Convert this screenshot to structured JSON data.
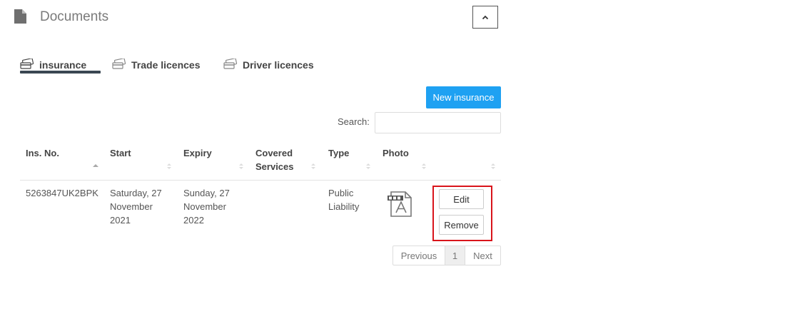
{
  "panel": {
    "title": "Documents",
    "icon": "document-icon",
    "collapse_icon": "chevron-up-icon"
  },
  "tabs": [
    {
      "label": "insurance",
      "icon": "cards-icon",
      "active": true
    },
    {
      "label": "Trade licences",
      "icon": "cards-icon",
      "active": false
    },
    {
      "label": "Driver licences",
      "icon": "cards-icon",
      "active": false
    }
  ],
  "toolbar": {
    "new_label": "New insurance",
    "search_label": "Search:",
    "search_value": ""
  },
  "table": {
    "columns": [
      "Ins. No.",
      "Start",
      "Expiry",
      "Covered Services",
      "Type",
      "Photo",
      ""
    ],
    "rows": [
      {
        "ins_no": "5263847UK2BPK",
        "start": "Saturday, 27 November 2021",
        "expiry": "Sunday, 27 November 2022",
        "covered_services": "",
        "type": "Public Liability",
        "photo": "pdf-file-icon",
        "edit_label": "Edit",
        "remove_label": "Remove"
      }
    ]
  },
  "pagination": {
    "previous": "Previous",
    "current": "1",
    "next": "Next"
  },
  "colors": {
    "primary": "#1ea1f2",
    "highlight": "#d9141b",
    "tab_underline": "#3a4752"
  }
}
